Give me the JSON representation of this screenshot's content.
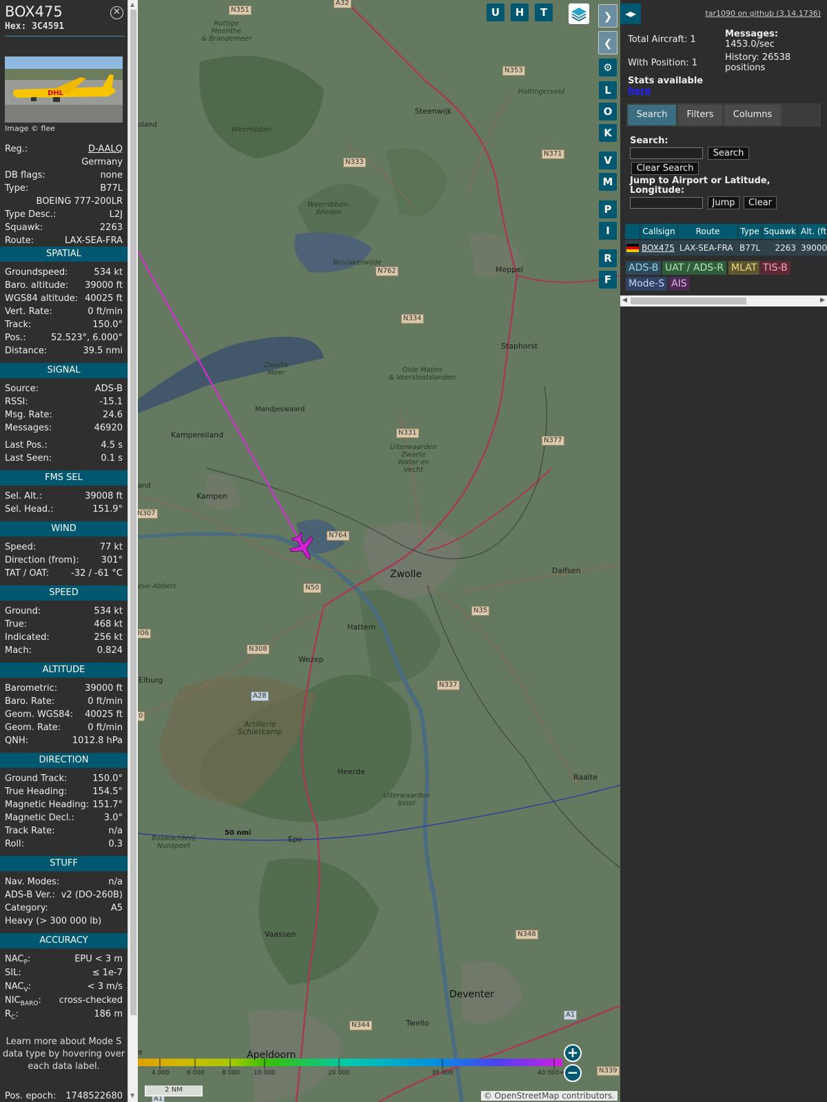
{
  "info": {
    "callsign": "BOX475",
    "hex_label": "Hex: 3C4591",
    "photo_credit": "Image © flee",
    "top_rows": [
      {
        "k": "Reg.:",
        "v": "D-AALQ",
        "link": true
      },
      {
        "k": "",
        "v": "Germany"
      },
      {
        "k": "DB flags:",
        "v": "none"
      },
      {
        "k": "Type:",
        "v": "B77L"
      },
      {
        "k": "",
        "v": "BOEING 777-200LR"
      },
      {
        "k": "Type Desc.:",
        "v": "L2J"
      },
      {
        "k": "Squawk:",
        "v": "2263"
      },
      {
        "k": "Route:",
        "v": "LAX-SEA-FRA"
      }
    ],
    "sections": [
      {
        "title": "SPATIAL",
        "rows": [
          {
            "k": "Groundspeed:",
            "v": "534 kt"
          },
          {
            "k": "Baro. altitude:",
            "v": "39000 ft"
          },
          {
            "k": "WGS84 altitude:",
            "v": "40025 ft"
          },
          {
            "k": "Vert. Rate:",
            "v": "0 ft/min"
          },
          {
            "k": "Track:",
            "v": "150.0°"
          },
          {
            "k": "Pos.:",
            "v": "52.523°, 6.000°"
          },
          {
            "k": "Distance:",
            "v": "39.5 nmi"
          }
        ]
      },
      {
        "title": "SIGNAL",
        "rows": [
          {
            "k": "Source:",
            "v": "ADS-B"
          },
          {
            "k": "RSSI:",
            "v": "-15.1"
          },
          {
            "k": "Msg. Rate:",
            "v": "24.6"
          },
          {
            "k": "Messages:",
            "v": "46920"
          },
          {
            "k": "Last Pos.:",
            "v": "4.5 s"
          },
          {
            "k": "Last Seen:",
            "v": "0.1 s"
          }
        ]
      },
      {
        "title": "FMS SEL",
        "rows": [
          {
            "k": "Sel. Alt.:",
            "v": "39008 ft"
          },
          {
            "k": "Sel. Head.:",
            "v": "151.9°"
          }
        ]
      },
      {
        "title": "WIND",
        "rows": [
          {
            "k": "Speed:",
            "v": "77 kt"
          },
          {
            "k": "Direction (from):",
            "v": "301°"
          },
          {
            "k": "TAT / OAT:",
            "v": "-32 / -61 °C"
          }
        ]
      },
      {
        "title": "SPEED",
        "rows": [
          {
            "k": "Ground:",
            "v": "534 kt"
          },
          {
            "k": "True:",
            "v": "468 kt"
          },
          {
            "k": "Indicated:",
            "v": "256 kt"
          },
          {
            "k": "Mach:",
            "v": "0.824"
          }
        ]
      },
      {
        "title": "ALTITUDE",
        "rows": [
          {
            "k": "Barometric:",
            "v": "39000 ft"
          },
          {
            "k": "Baro. Rate:",
            "v": "0 ft/min"
          },
          {
            "k": "Geom. WGS84:",
            "v": "40025 ft"
          },
          {
            "k": "Geom. Rate:",
            "v": "0 ft/min"
          },
          {
            "k": "QNH:",
            "v": "1012.8 hPa"
          }
        ]
      },
      {
        "title": "DIRECTION",
        "rows": [
          {
            "k": "Ground Track:",
            "v": "150.0°"
          },
          {
            "k": "True Heading:",
            "v": "154.5°"
          },
          {
            "k": "Magnetic Heading:",
            "v": "151.7°"
          },
          {
            "k": "Magnetic Decl.:",
            "v": "3.0°"
          },
          {
            "k": "Track Rate:",
            "v": "n/a"
          },
          {
            "k": "Roll:",
            "v": "0.3"
          }
        ]
      },
      {
        "title": "STUFF",
        "rows": [
          {
            "k": "Nav. Modes:",
            "v": "n/a"
          },
          {
            "k": "ADS-B Ver.:",
            "v": "v2 (DO-260B)"
          },
          {
            "k": "Category:",
            "v": "A5"
          },
          {
            "k": "Heavy (> 300 000 lb)",
            "v": ""
          }
        ]
      },
      {
        "title": "ACCURACY",
        "rows": [
          {
            "k": "NACP:",
            "v": "EPU < 3 m"
          },
          {
            "k": "SIL:",
            "v": "≤ 1e-7"
          },
          {
            "k": "NACV:",
            "v": "< 3 m/s"
          },
          {
            "k": "NICBARO:",
            "v": "cross-checked"
          },
          {
            "k": "RC:",
            "v": "186 m"
          }
        ]
      }
    ],
    "note": [
      "Learn more about Mode S",
      "data type by hovering over",
      "each data label."
    ],
    "last_row": {
      "k": "Pos. epoch:",
      "v": "1748522680"
    }
  },
  "map": {
    "buttons_top": [
      "U",
      "H",
      "T"
    ],
    "buttons_side": [
      "L",
      "O",
      "K",
      "V",
      "M",
      "P",
      "I",
      "R",
      "F"
    ],
    "range_ring_label": "50 nmi",
    "scale_label": "2 NM",
    "attribution": "© OpenStreetMap contributors.",
    "altitude_ticks": [
      "4 000",
      "6 000",
      "8 000",
      "10 000",
      "20 000",
      "30 000",
      "40 000+"
    ],
    "places": {
      "zwolle": "Zwolle",
      "kampen": "Kampen",
      "kampereiland": "Kampereiland",
      "mandjeswaard": "Mandjeswaard",
      "steenwijk": "Steenwijk",
      "meppel": "Meppel",
      "staphorst": "Staphorst",
      "dalfsen": "Dalfsen",
      "hattem": "Hattem",
      "wezep": "Wezep",
      "heerde": "Heerde",
      "epe": "Epe",
      "vaassen": "Vaassen",
      "deventer": "Deventer",
      "twello": "Twello",
      "apeldoorn": "Apeldoorn",
      "raalte": "Raalte",
      "elburg": "Elburg",
      "weerribben": "Weerribben",
      "weerribben_wieden": "Weerribben-\nWieden",
      "beulakerwijde": "Beulakerwijde",
      "zwarte_meer": "Zwarte\nMeer",
      "olde_maten": "Olde Maten\n& Veerslootslanden",
      "uiterwaarden": "Uiterwaarden\nZwarte\nWater en\nVecht",
      "artillerie": "Artillerie\nSchietkamp",
      "rottige": "Rottige\nMeenthe\n& Brandemeer",
      "holtingerveld": "Holtingerveld",
      "uiterwaarden_ijssel": "Uiterwaarden\nIJssel",
      "boswachterij": "Boswachterij\nNunspeet",
      "eve_abbert": "eve-Abbert",
      "roland": "oland",
      "land": "and",
      "e_left": "e"
    },
    "roads": {
      "n351": "N351",
      "a32": "A32",
      "n353": "N353",
      "n371": "N371",
      "n333": "N333",
      "n762": "N762",
      "n334": "N334",
      "n331": "N331",
      "n377": "N377",
      "n307": "N307",
      "n764": "N764",
      "n50": "N50",
      "n35": "N35",
      "n306": "306",
      "n308": "N308",
      "a28": "A28",
      "n337": "N337",
      "n348": "N348",
      "n344": "N344",
      "a1": "A1",
      "n339": "N339",
      "a1b": "A1",
      "r0": "0"
    }
  },
  "side": {
    "version": "tar1090 on github (3.14.1736)",
    "total_aircraft": "Total Aircraft: 1",
    "with_position": "With Position: 1",
    "messages_label": "Messages:",
    "messages_value": "1453.0/sec",
    "history_label": "History: 26538",
    "history_value": "positions",
    "stats_text": "Stats available",
    "stats_link": "here",
    "tabs": [
      "Search",
      "Filters",
      "Columns"
    ],
    "search_label": "Search:",
    "search_button": "Search",
    "clear_search_button": "Clear Search",
    "jump_label_1": "Jump to Airport or Latitude,",
    "jump_label_2": "Longitude:",
    "jump_button": "Jump",
    "clear_button": "Clear",
    "table": {
      "headers": [
        "",
        "Callsign",
        "Route",
        "Type",
        "Squawk",
        "Alt. (ft)"
      ],
      "rows": [
        [
          "",
          "BOX475",
          "LAX-SEA-FRA",
          "B77L",
          "2263",
          "39000"
        ]
      ]
    },
    "badges": [
      {
        "label": "ADS-B",
        "bg": "#2c4a5a",
        "fg": "#9fd4f0"
      },
      {
        "label": "UAT / ADS-R",
        "bg": "#2f5c3b",
        "fg": "#b6e8b6"
      },
      {
        "label": "MLAT",
        "bg": "#5e5430",
        "fg": "#f3dd8a"
      },
      {
        "label": "TIS-B",
        "bg": "#5d2937",
        "fg": "#f5a8b8"
      },
      {
        "label": "Mode-S",
        "bg": "#314262",
        "fg": "#c6d2ff"
      },
      {
        "label": "AIS",
        "bg": "#4d2a52",
        "fg": "#e5b6f0"
      }
    ]
  }
}
